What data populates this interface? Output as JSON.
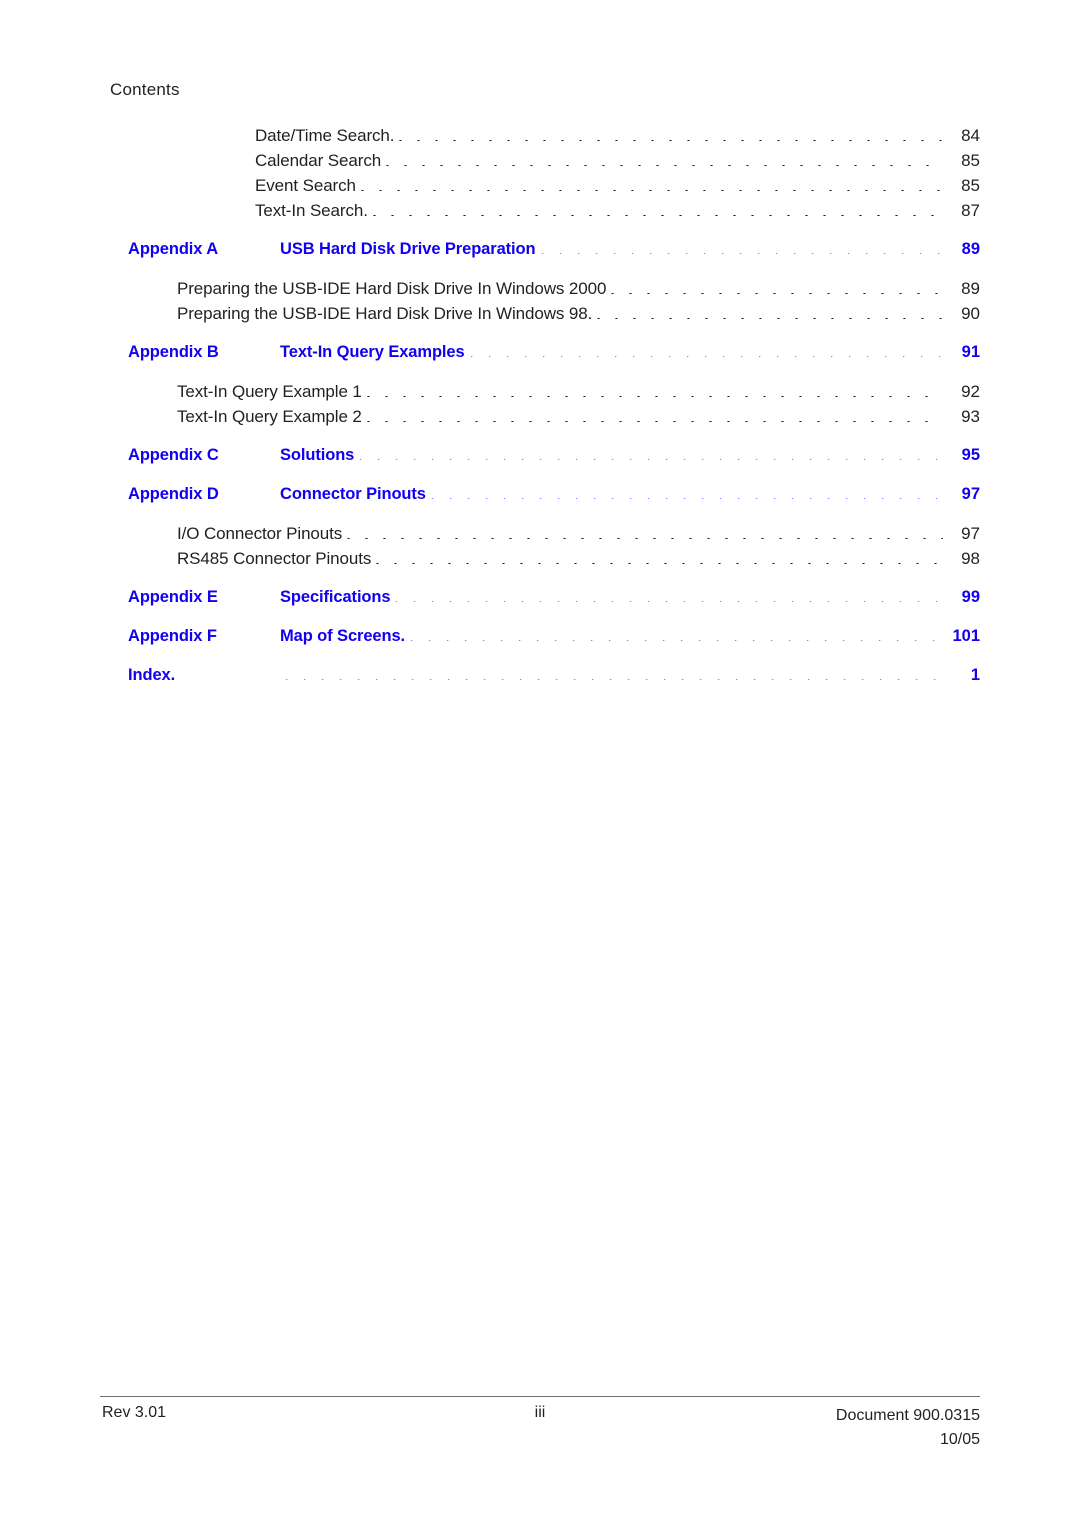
{
  "running_header": "Contents",
  "colors": {
    "appendix_blue": "#1200f0",
    "body_text": "#231f20",
    "footer_rule": "#6d6e71"
  },
  "toc": {
    "entries": [
      {
        "level": "2",
        "label": "",
        "title": "Date/Time Search.",
        "page": "84",
        "gap_before": false
      },
      {
        "level": "2",
        "label": "",
        "title": "Calendar Search",
        "page": "85",
        "gap_before": false
      },
      {
        "level": "2",
        "label": "",
        "title": "Event Search",
        "page": "85",
        "gap_before": false
      },
      {
        "level": "2",
        "label": "",
        "title": "Text-In Search.",
        "page": "87",
        "gap_before": false
      },
      {
        "level": "app",
        "label": "Appendix A",
        "title": "USB Hard Disk Drive Preparation",
        "page": "89",
        "gap_before": true
      },
      {
        "level": "1",
        "label": "",
        "title": "Preparing the USB-IDE Hard Disk Drive In Windows 2000",
        "page": "89",
        "gap_before": true
      },
      {
        "level": "1",
        "label": "",
        "title": "Preparing the USB-IDE Hard Disk Drive In Windows 98.",
        "page": "90",
        "gap_before": false
      },
      {
        "level": "app",
        "label": "Appendix B",
        "title": "Text-In Query Examples",
        "page": "91",
        "gap_before": true
      },
      {
        "level": "1",
        "label": "",
        "title": "Text-In Query Example 1",
        "page": "92",
        "gap_before": true
      },
      {
        "level": "1",
        "label": "",
        "title": "Text-In Query Example 2",
        "page": "93",
        "gap_before": false
      },
      {
        "level": "app",
        "label": "Appendix C",
        "title": "Solutions",
        "page": "95",
        "gap_before": true
      },
      {
        "level": "app",
        "label": "Appendix D",
        "title": "Connector Pinouts",
        "page": "97",
        "gap_before": true
      },
      {
        "level": "1",
        "label": "",
        "title": "I/O Connector Pinouts",
        "page": "97",
        "gap_before": true
      },
      {
        "level": "1",
        "label": "",
        "title": "RS485 Connector Pinouts",
        "page": "98",
        "gap_before": false
      },
      {
        "level": "app",
        "label": "Appendix E",
        "title": "Specifications",
        "page": "99",
        "gap_before": true
      },
      {
        "level": "app",
        "label": "Appendix F",
        "title": "Map of Screens.",
        "page": "101",
        "gap_before": true
      },
      {
        "level": "app",
        "label": "Index.",
        "title": "",
        "page": "1",
        "gap_before": true
      }
    ]
  },
  "footer": {
    "left": "Rev 3.01",
    "center": "iii",
    "right_line1": "Document 900.0315",
    "right_line2": "10/05"
  }
}
